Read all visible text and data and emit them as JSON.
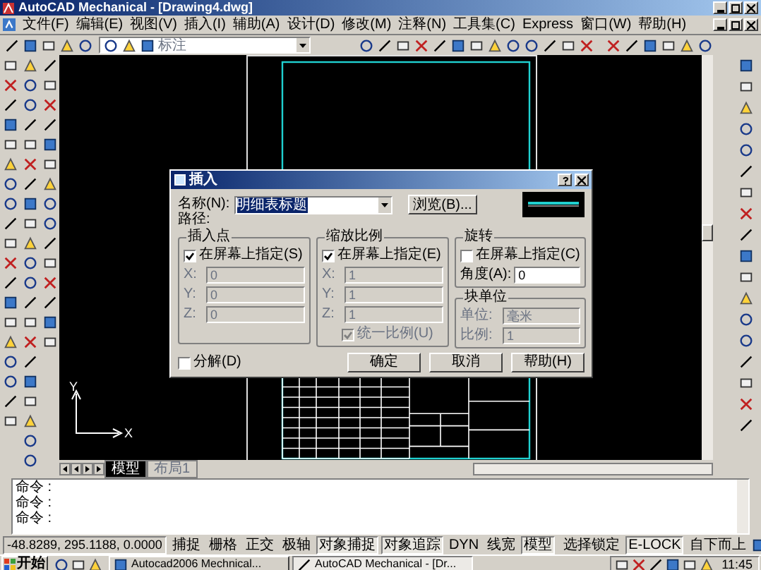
{
  "window": {
    "title": "AutoCAD Mechanical - [Drawing4.dwg]"
  },
  "menu": [
    "文件(F)",
    "编辑(E)",
    "视图(V)",
    "插入(I)",
    "辅助(A)",
    "设计(D)",
    "修改(M)",
    "注释(N)",
    "工具集(C)",
    "Express",
    "窗口(W)",
    "帮助(H)"
  ],
  "layer_dropdown": {
    "value": "标注"
  },
  "ucs": {
    "x_label": "X",
    "y_label": "Y"
  },
  "layout_tabs": [
    {
      "label": "模型",
      "selected": true
    },
    {
      "label": "布局1",
      "selected": false
    }
  ],
  "command_lines": [
    "命令 :",
    "命令 :",
    "命令 :"
  ],
  "status_bar": {
    "coordinates": "-48.8289, 295.1188, 0.0000",
    "toggles": [
      {
        "label": "捕捉",
        "on": false
      },
      {
        "label": "栅格",
        "on": false
      },
      {
        "label": "正交",
        "on": false
      },
      {
        "label": "极轴",
        "on": false
      },
      {
        "label": "对象捕捉",
        "on": true
      },
      {
        "label": "对象追踪",
        "on": true
      },
      {
        "label": "DYN",
        "on": false
      },
      {
        "label": "线宽",
        "on": false
      },
      {
        "label": "模型",
        "on": true
      }
    ],
    "extras": [
      {
        "label": "选择锁定",
        "on": false
      },
      {
        "label": "E-LOCK",
        "on": true
      },
      {
        "label": "自下而上",
        "on": false
      }
    ]
  },
  "taskbar": {
    "start": "开始",
    "tasks": [
      {
        "label": "Autocad2006 Mechnical...",
        "selected": false
      },
      {
        "label": "AutoCAD Mechanical - [Dr...",
        "selected": true
      }
    ],
    "clock": "11:45"
  },
  "insert_dialog": {
    "title": "插入",
    "name_label": "名称(N):",
    "name_value": "明细表标题",
    "browse": "浏览(B)...",
    "path_label": "路径:",
    "groups": [
      {
        "kind": "xyz",
        "title": "插入点",
        "checkbox": {
          "label": "在屏幕上指定(S)",
          "checked": true
        },
        "fields": [
          {
            "label": "X:",
            "value": "0"
          },
          {
            "label": "Y:",
            "value": "0"
          },
          {
            "label": "Z:",
            "value": "0"
          }
        ]
      },
      {
        "kind": "xyz",
        "title": "缩放比例",
        "checkbox": {
          "label": "在屏幕上指定(E)",
          "checked": true
        },
        "fields": [
          {
            "label": "X:",
            "value": "1"
          },
          {
            "label": "Y:",
            "value": "1"
          },
          {
            "label": "Z:",
            "value": "1"
          }
        ],
        "uniform": {
          "label": "统一比例(U)",
          "checked": true,
          "disabled": true
        }
      },
      {
        "kind": "rotation",
        "title": "旋转",
        "checkbox": {
          "label": "在屏幕上指定(C)",
          "checked": false
        },
        "angle": {
          "label": "角度(A):",
          "value": "0"
        }
      }
    ],
    "block_unit": {
      "title": "块单位",
      "unit_label": "单位:",
      "unit_value": "毫米",
      "scale_label": "比例:",
      "scale_value": "1"
    },
    "explode": {
      "label": "分解(D)",
      "checked": false
    },
    "buttons": [
      "确定",
      "取消",
      "帮助(H)"
    ]
  }
}
